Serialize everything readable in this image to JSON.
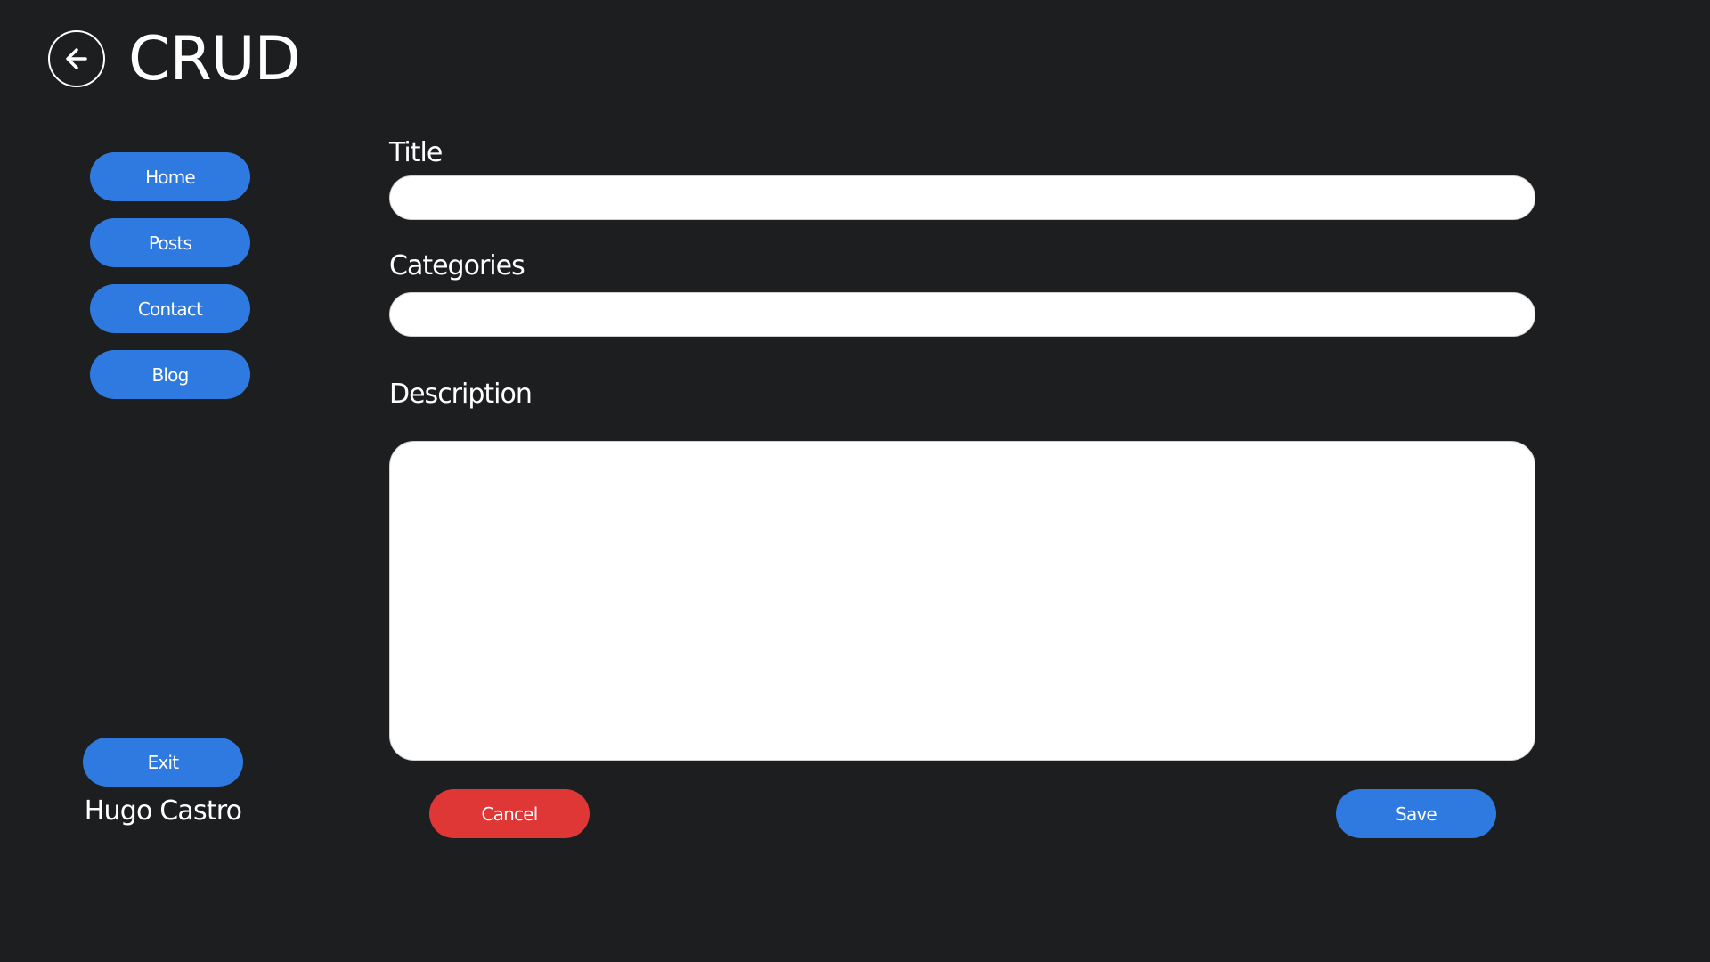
{
  "header": {
    "title": "CRUD",
    "back_icon": "arrow-left-circle-icon"
  },
  "sidebar": {
    "items": [
      {
        "label": "Home"
      },
      {
        "label": "Posts"
      },
      {
        "label": "Contact"
      },
      {
        "label": "Blog"
      }
    ],
    "exit_label": "Exit",
    "user_name": "Hugo Castro"
  },
  "form": {
    "title_label": "Title",
    "title_value": "",
    "categories_label": "Categories",
    "categories_value": "",
    "description_label": "Description",
    "description_value": "",
    "cancel_label": "Cancel",
    "save_label": "Save"
  },
  "colors": {
    "background": "#1d1e20",
    "primary_button": "#2f7ae0",
    "danger_button": "#df3636",
    "text": "#ffffff"
  }
}
